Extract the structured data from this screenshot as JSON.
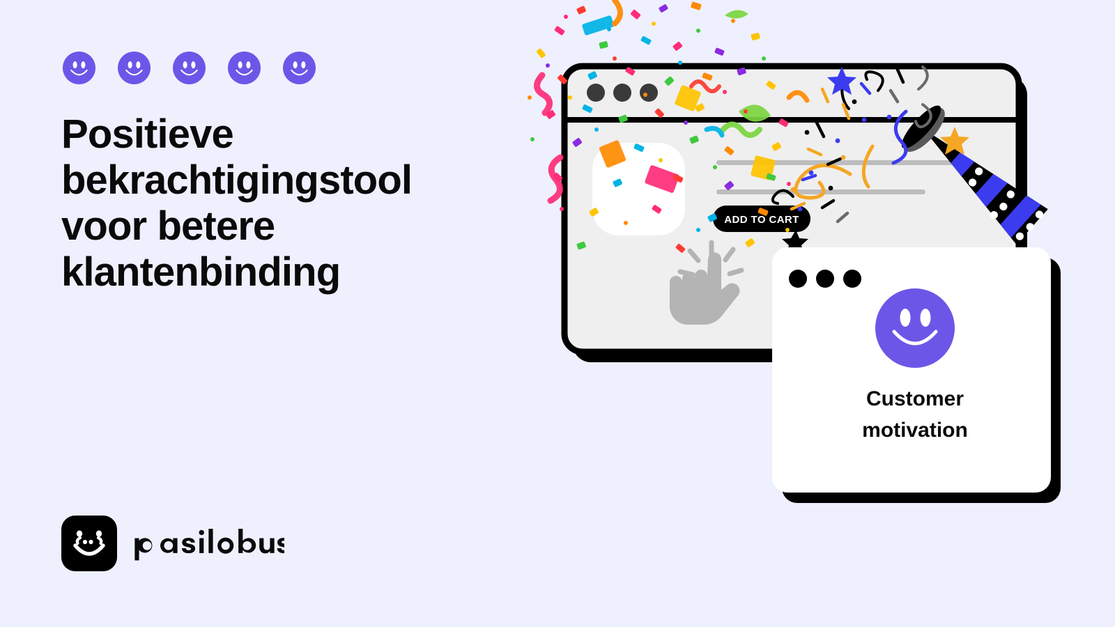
{
  "page": {
    "background_color": "#eff0fe",
    "accent_color": "#6c56e8",
    "text_color": "#0a0a0a"
  },
  "hero": {
    "headline": "Positieve bekrachtigingstool voor betere klantenbinding",
    "rating_icons": [
      "smiley-icon",
      "smiley-icon",
      "smiley-icon",
      "smiley-icon",
      "smiley-icon"
    ],
    "rating_count": 5
  },
  "brand": {
    "name": "pasilobus",
    "mark_icon": "smiling-face-logo-icon",
    "mark_background": "#000000",
    "mark_foreground": "#ffffff"
  },
  "illustration": {
    "browser_window": {
      "traffic_lights": 3,
      "traffic_light_color": "#3a3a3a",
      "border_color": "#000000",
      "surface_color": "#efefef",
      "product_image_placeholder": "product-image-placeholder",
      "text_lines": 2,
      "text_line_color": "#bdbdbd",
      "cta_button_label": "ADD TO CART",
      "cta_button_color": "#000000",
      "cta_text_color": "#ffffff",
      "cursor_icon": "pointing-hand-cursor-icon",
      "cursor_color": "#b4b4b4"
    },
    "motivation_card": {
      "traffic_lights": 3,
      "traffic_light_color": "#000000",
      "smiley_icon": "smiley-icon",
      "smiley_color": "#6c56e8",
      "title_line_1": "Customer",
      "title_line_2": "motivation",
      "surface_color": "#ffffff",
      "shadow_color": "#000000"
    },
    "party_popper": {
      "icon": "party-popper-icon",
      "cone_colors": [
        "#000000",
        "#3b3bf0",
        "#5a5a5a"
      ],
      "dot_color": "#ffffff",
      "streamer_colors": [
        "#f5a623",
        "#3b3bf0",
        "#000000",
        "#6a6a6a"
      ],
      "star_colors": [
        "#3b3bf0",
        "#f5a623",
        "#000000"
      ]
    },
    "confetti": {
      "colors": [
        "#ff2d78",
        "#ff3b30",
        "#00b4e6",
        "#3fc93f",
        "#ffc400",
        "#ff8a00",
        "#8a2be2",
        "#00c2a8",
        "#ff6ea9",
        "#7cd63f"
      ],
      "piece_count": 150
    }
  }
}
